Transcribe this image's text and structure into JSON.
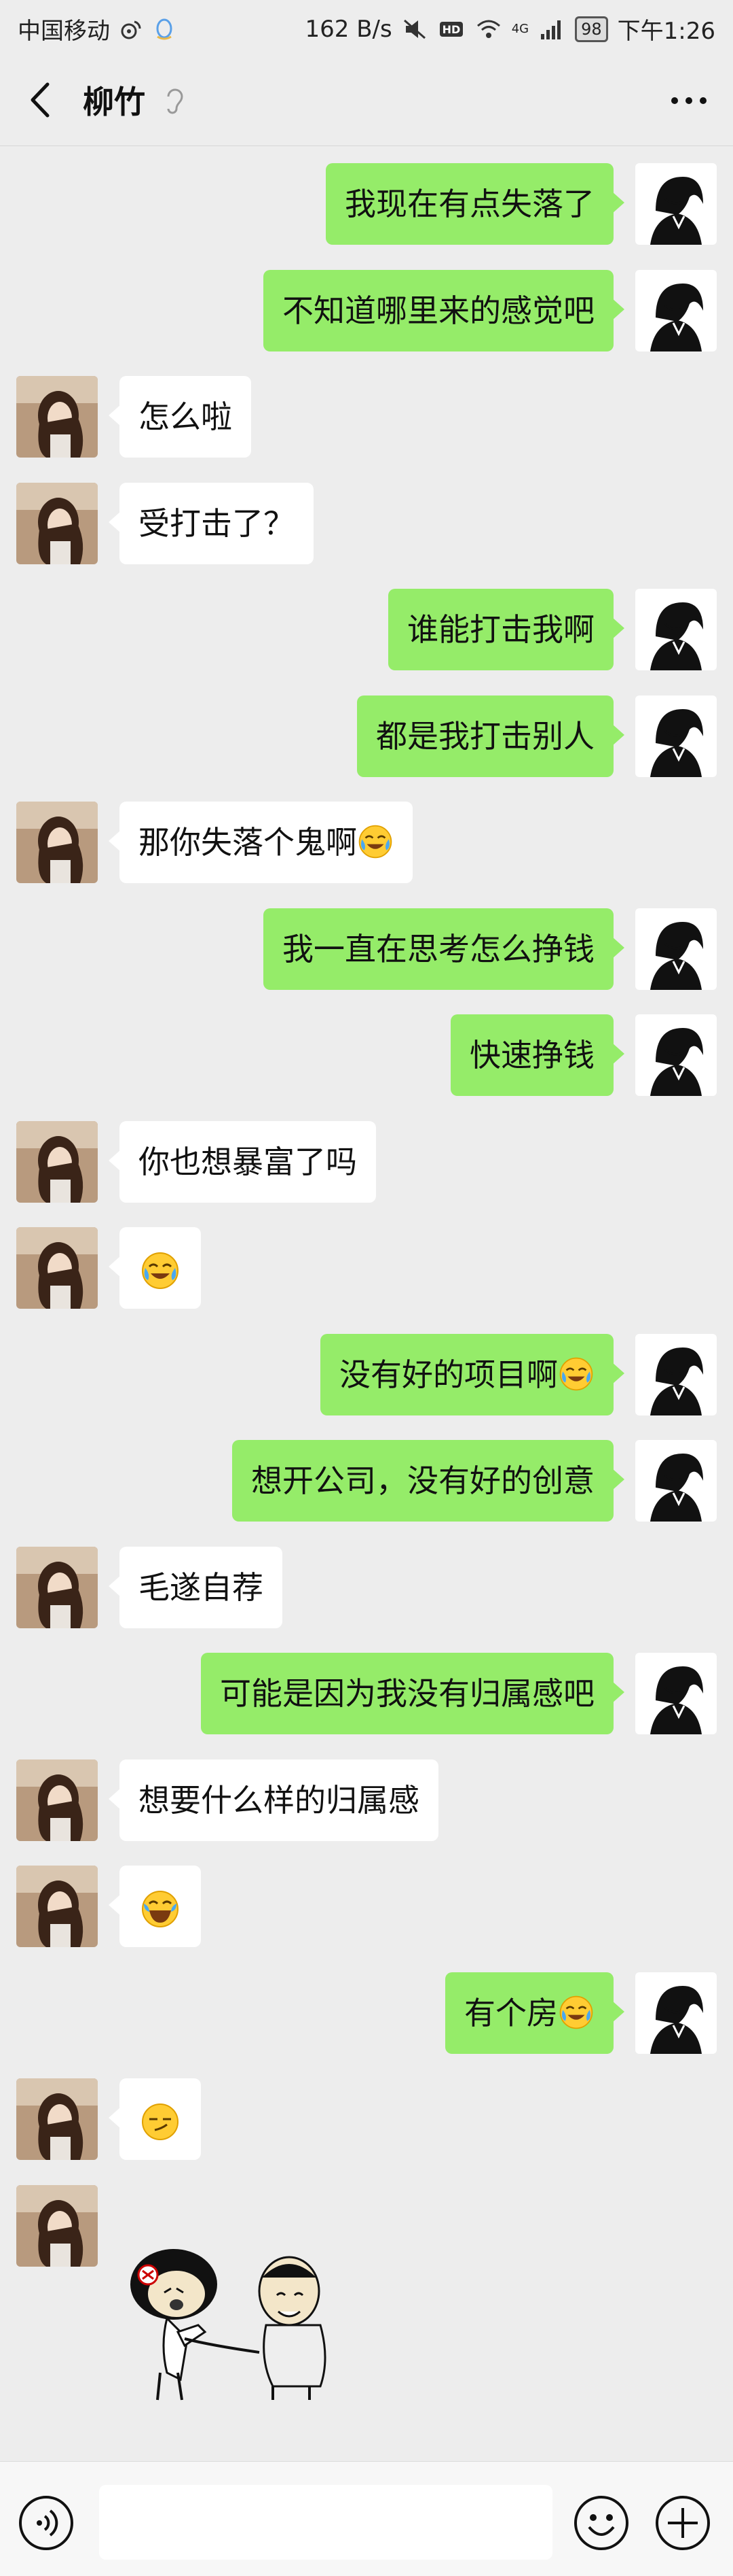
{
  "status_bar": {
    "carrier": "中国移动",
    "net_speed": "162 B/s",
    "battery": "98",
    "time": "下午1:26",
    "signal_label": "4G"
  },
  "header": {
    "title": "柳竹"
  },
  "messages": [
    {
      "side": "out",
      "text": "我现在有点失落了",
      "emoji": ""
    },
    {
      "side": "out",
      "text": "不知道哪里来的感觉吧",
      "emoji": ""
    },
    {
      "side": "in",
      "text": "怎么啦",
      "emoji": ""
    },
    {
      "side": "in",
      "text": "受打击了？",
      "emoji": ""
    },
    {
      "side": "out",
      "text": "谁能打击我啊",
      "emoji": ""
    },
    {
      "side": "out",
      "text": "都是我打击别人",
      "emoji": ""
    },
    {
      "side": "in",
      "text": "那你失落个鬼啊",
      "emoji": "laugh-cry"
    },
    {
      "side": "out",
      "text": "我一直在思考怎么挣钱",
      "emoji": ""
    },
    {
      "side": "out",
      "text": "快速挣钱",
      "emoji": ""
    },
    {
      "side": "in",
      "text": "你也想暴富了吗",
      "emoji": ""
    },
    {
      "side": "in",
      "text": "",
      "emoji": "laugh-cry"
    },
    {
      "side": "out",
      "text": "没有好的项目啊",
      "emoji": "laugh-cry"
    },
    {
      "side": "out",
      "text": "想开公司，没有好的创意",
      "emoji": ""
    },
    {
      "side": "in",
      "text": "毛遂自荐",
      "emoji": ""
    },
    {
      "side": "out",
      "text": "可能是因为我没有归属感吧",
      "emoji": ""
    },
    {
      "side": "in",
      "text": "想要什么样的归属感",
      "emoji": ""
    },
    {
      "side": "in",
      "text": "",
      "emoji": "joy"
    },
    {
      "side": "out",
      "text": "有个房",
      "emoji": "laugh-cry"
    },
    {
      "side": "in",
      "text": "",
      "emoji": "smirk"
    }
  ],
  "sticker": {
    "from": "in",
    "icon": "kick-meme-sticker"
  },
  "input_bar": {
    "value": "",
    "placeholder": ""
  },
  "colors": {
    "background": "#ededed",
    "outgoing_bubble": "#95ec69",
    "incoming_bubble": "#ffffff"
  }
}
